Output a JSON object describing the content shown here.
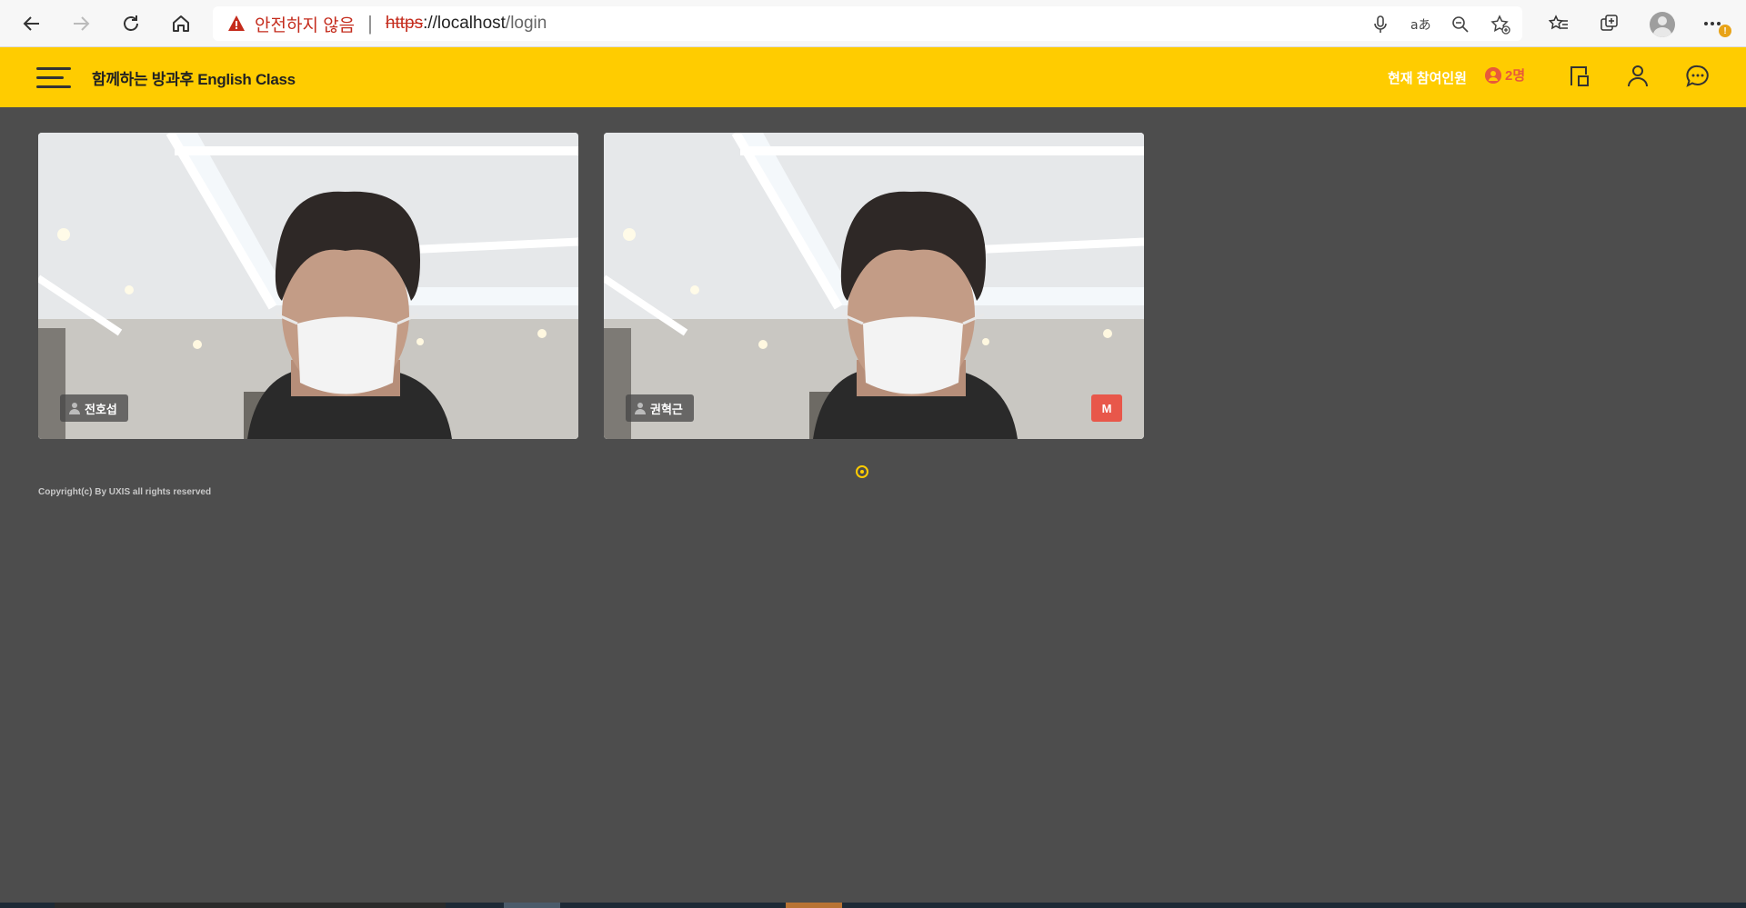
{
  "browser": {
    "security_warning": "안전하지 않음",
    "url_scheme": "https",
    "url_host": "://localhost",
    "url_path": "/login"
  },
  "app": {
    "title": "함께하는 방과후 English Class",
    "participants_label": "현재 참여인원",
    "participants_count": "2명"
  },
  "videos": [
    {
      "name": "전호섭",
      "badge": ""
    },
    {
      "name": "권혁근",
      "badge": "M"
    }
  ],
  "footer": {
    "copyright": "Copyright(c) By UXIS all rights reserved"
  },
  "colors": {
    "header_bg": "#ffcc00",
    "page_bg": "#4d4d4d",
    "warning": "#c42b1c",
    "badge": "#e8574a"
  }
}
